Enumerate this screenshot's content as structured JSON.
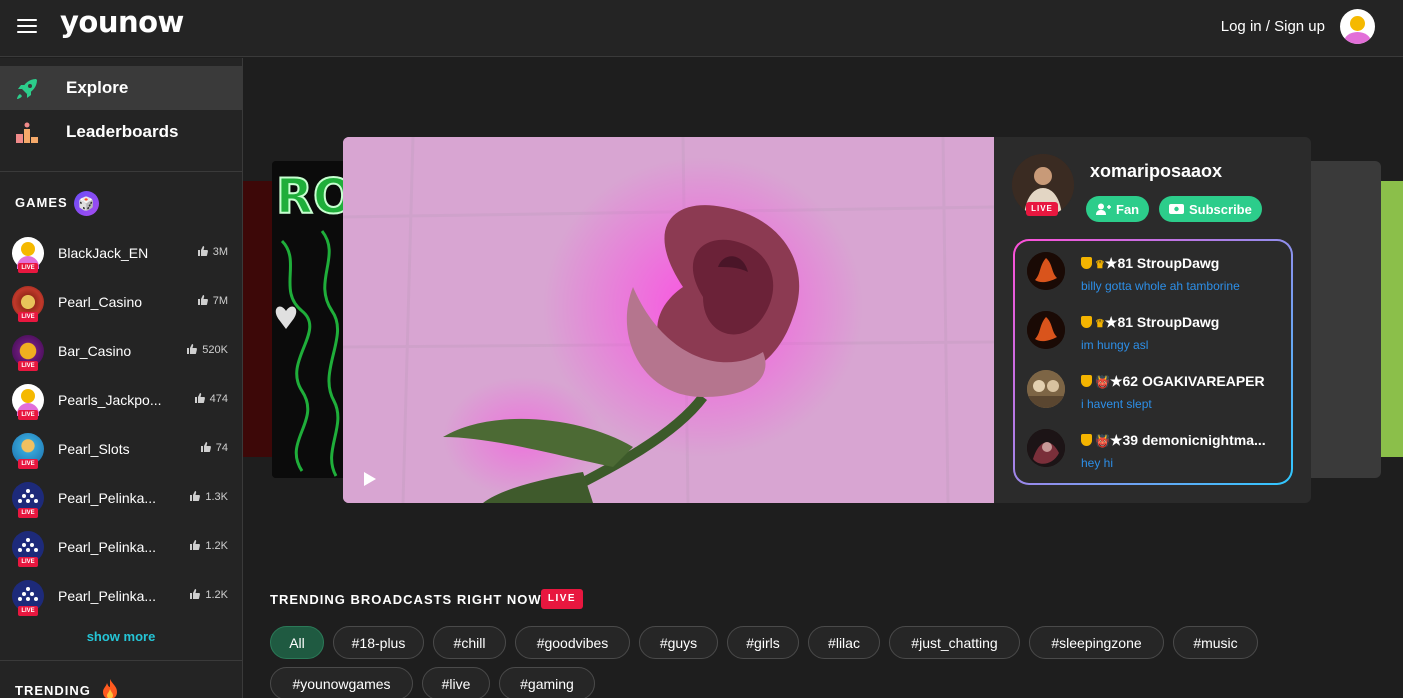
{
  "header": {
    "logo": "younow",
    "login_label": "Log in / Sign up"
  },
  "sidebar": {
    "nav": [
      {
        "label": "Explore",
        "icon": "rocket-icon",
        "active": true
      },
      {
        "label": "Leaderboards",
        "icon": "podium-icon",
        "active": false
      }
    ],
    "games_title": "GAMES",
    "games": [
      {
        "name": "BlackJack_EN",
        "likes": "3M",
        "live": "LIVE",
        "color": "#ffffff"
      },
      {
        "name": "Pearl_Casino",
        "likes": "7M",
        "live": "LIVE",
        "color": "#c0392b"
      },
      {
        "name": "Bar_Casino",
        "likes": "520K",
        "live": "LIVE",
        "color": "#7a2a8a"
      },
      {
        "name": "Pearls_Jackpo...",
        "likes": "474",
        "live": "LIVE",
        "color": "#ffffff"
      },
      {
        "name": "Pearl_Slots",
        "likes": "74",
        "live": "LIVE",
        "color": "#35a4d8"
      },
      {
        "name": "Pearl_Pelinka...",
        "likes": "1.3K",
        "live": "LIVE",
        "color": "#1d2a7a"
      },
      {
        "name": "Pearl_Pelinka...",
        "likes": "1.2K",
        "live": "LIVE",
        "color": "#1d2a7a"
      },
      {
        "name": "Pearl_Pelinka...",
        "likes": "1.2K",
        "live": "LIVE",
        "color": "#1d2a7a"
      }
    ],
    "show_more": "show more",
    "trending_title": "TRENDING"
  },
  "featured": {
    "streamer": "xomariposaaox",
    "live": "LIVE",
    "fan_label": "Fan",
    "subscribe_label": "Subscribe",
    "chat": [
      {
        "level": "81",
        "user": "StroupDawg",
        "message": "billy gotta whole ah tamborine",
        "badge": "crown"
      },
      {
        "level": "81",
        "user": "StroupDawg",
        "message": "im hungy asl",
        "badge": "crown"
      },
      {
        "level": "62",
        "user": "OGAKIVAREAPER",
        "message": "i havent slept",
        "badge": "devil"
      },
      {
        "level": "39",
        "user": "demonicnightma...",
        "message": "hey hi",
        "badge": "devil"
      }
    ]
  },
  "trending": {
    "title": "TRENDING BROADCASTS RIGHT NOW",
    "live": "LIVE",
    "tags": [
      "All",
      "#18-plus",
      "#chill",
      "#goodvibes",
      "#guys",
      "#girls",
      "#lilac",
      "#just_chatting",
      "#sleepingzone",
      "#music",
      "#younowgames",
      "#live",
      "#gaming"
    ]
  },
  "colors": {
    "accent_green": "#2ccd8b",
    "live_red": "#e8173f",
    "link_cyan": "#25c5d6",
    "chat_blue": "#2d8fe8"
  }
}
